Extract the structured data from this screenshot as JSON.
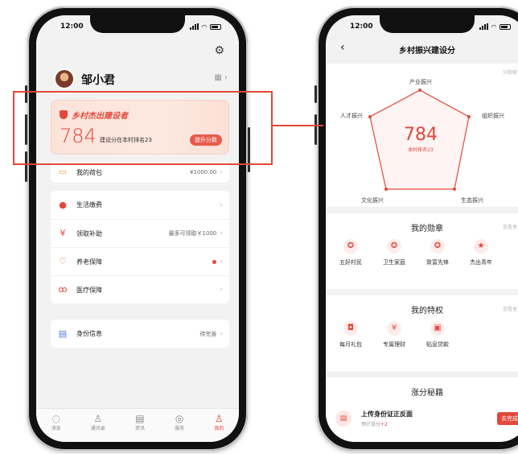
{
  "left_phone": {
    "status_time": "12:00",
    "user_name": "邹小君",
    "score_card": {
      "title": "乡村杰出建设者",
      "score": "784",
      "rank_text": "建设分在本村排名23",
      "button_label": "提升分数"
    },
    "wallet": {
      "label": "我的荷包",
      "value": "¥1000.00"
    },
    "services": [
      {
        "label": "生活缴费",
        "value": "",
        "icon": "drop-icon"
      },
      {
        "label": "领取补助",
        "value": "最多可领取￥1000",
        "icon": "yuan-icon"
      },
      {
        "label": "养老保障",
        "value": "",
        "icon": "heart-shield-icon",
        "dot": true
      },
      {
        "label": "医疗保障",
        "value": "",
        "icon": "stethoscope-icon"
      }
    ],
    "identity": {
      "label": "身份信息",
      "value": "待完善"
    },
    "tabs": [
      {
        "label": "消息",
        "icon": "chat-icon"
      },
      {
        "label": "通讯录",
        "icon": "contacts-icon"
      },
      {
        "label": "资讯",
        "icon": "news-icon"
      },
      {
        "label": "服务",
        "icon": "compass-icon"
      },
      {
        "label": "我的",
        "icon": "user-icon",
        "active": true
      }
    ]
  },
  "right_phone": {
    "status_time": "12:00",
    "title": "乡村振兴建设分",
    "explain_link": "分数解读",
    "radar": {
      "score": "784",
      "rank": "本村排名23",
      "axes": [
        "产业振兴",
        "组织振兴",
        "生态振兴",
        "文化振兴",
        "人才振兴"
      ]
    },
    "medals": {
      "title": "我的勋章",
      "more": "查看更多",
      "items": [
        "五好村民",
        "卫生家庭",
        "致富先锋",
        "杰出青年"
      ]
    },
    "privileges": {
      "title": "我的特权",
      "more": "查看更多",
      "items": [
        "每月礼包",
        "专属理财",
        "贴息贷款"
      ]
    },
    "boost": {
      "title": "涨分秘籍",
      "task_title": "上传身份证正反面",
      "task_sub": "预计涨分",
      "task_points": "+2",
      "task_button": "去完成"
    }
  },
  "colors": {
    "accent": "#e3473a",
    "card_bg": "#fbe3da",
    "screen_bg": "#f2f2f2"
  }
}
